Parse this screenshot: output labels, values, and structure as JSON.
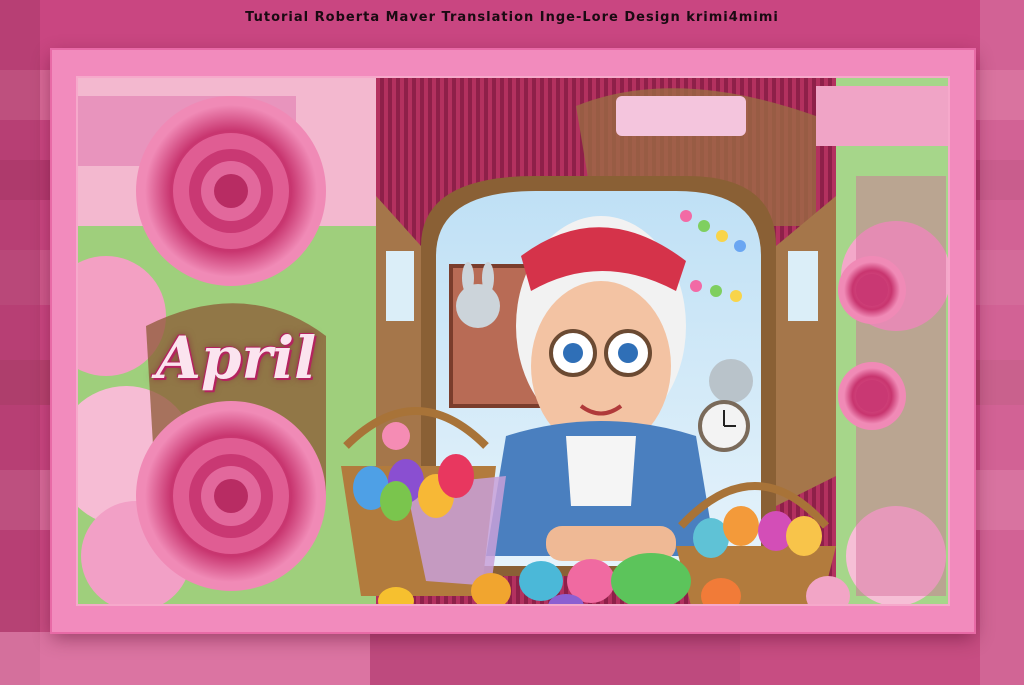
{
  "caption": "Tutorial Roberta Maver Translation Inge-Lore  Design krimi4mimi",
  "title_word": "April",
  "colors": {
    "pink_bright": "#f28bbd",
    "pink_dark": "#c2417d",
    "rosette": "#d5407e",
    "window_wood": "#a5764a",
    "sky": "#cfe6f5"
  }
}
